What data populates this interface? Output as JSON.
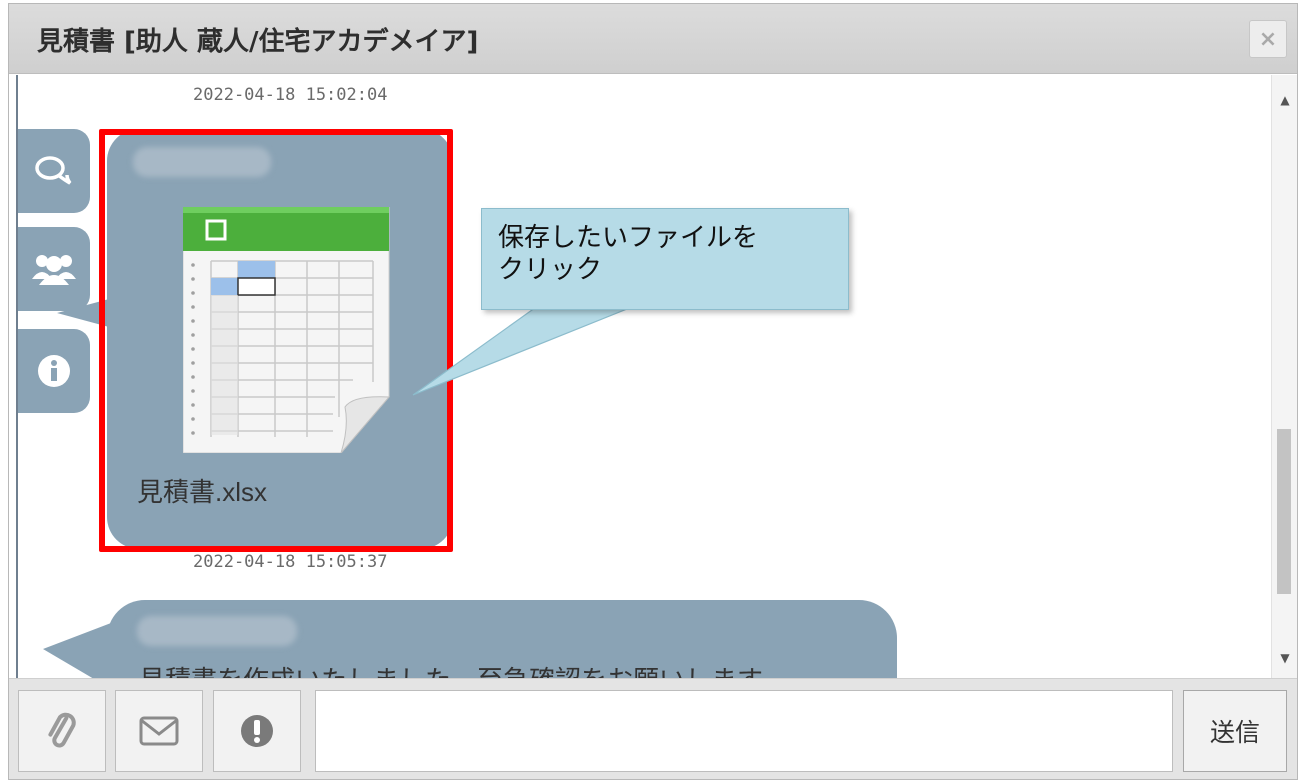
{
  "window": {
    "title": "見積書 [助人 蔵人/住宅アカデメイア]",
    "close_label": "×"
  },
  "chat": {
    "timestamp_top": "2022-04-18 15:02:04",
    "file_message": {
      "file_name": "見積書.xlsx"
    },
    "timestamp_file": "2022-04-18 15:05:37",
    "text_message": "見積書を作成いたしました。至急確認をお願いします"
  },
  "side_tabs": [
    "chat-icon",
    "users-icon",
    "info-icon"
  ],
  "callout": {
    "line1": "保存したいファイルを",
    "line2": "クリック"
  },
  "toolbar": {
    "attach_icon": "paperclip-icon",
    "mail_icon": "envelope-icon",
    "important_icon": "exclamation-icon",
    "send_label": "送信"
  },
  "colors": {
    "bubble": "#8aa3b5",
    "highlight": "#ff0000",
    "callout": "#b6dbe7"
  }
}
